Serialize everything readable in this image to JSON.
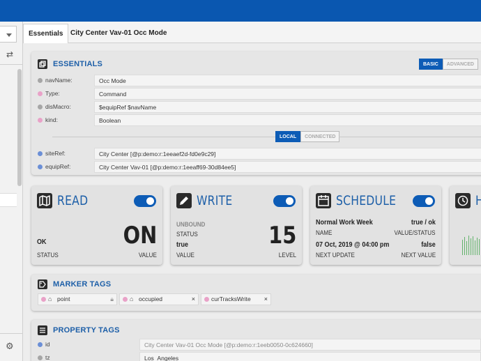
{
  "tabs": [
    "Essentials",
    "City Center Vav-01 Occ Mode"
  ],
  "essentials": {
    "title": "ESSENTIALS",
    "mode_basic": "BASIC",
    "mode_advanced": "ADVANCED",
    "local": "LOCAL",
    "connected": "CONNECTED",
    "rows": [
      {
        "label": "navName:",
        "value": "Occ Mode",
        "color": "#a6a6a6"
      },
      {
        "label": "Type:",
        "value": "Command",
        "color": "#e9a2c8"
      },
      {
        "label": "disMacro:",
        "value": "$equipRef $navName",
        "color": "#a6a6a6"
      },
      {
        "label": "kind:",
        "value": "Boolean",
        "color": "#e9a2c8"
      }
    ],
    "refs": [
      {
        "label": "siteRef:",
        "value": "City Center [@p:demo:r:1eeaef2d-fd0e9c29]",
        "color": "#6b8fd6"
      },
      {
        "label": "equipRef:",
        "value": "City Center Vav-01 [@p:demo:r:1eeaff69-30d84ee5]",
        "color": "#6b8fd6"
      }
    ]
  },
  "read": {
    "title": "READ",
    "value": "ON",
    "status": "OK",
    "status_label": "STATUS",
    "value_label": "VALUE"
  },
  "write": {
    "title": "WRITE",
    "unbound": "UNBOUND",
    "status_label": "STATUS",
    "val": "true",
    "value_label": "VALUE",
    "level": "15",
    "level_label": "LEVEL"
  },
  "schedule": {
    "title": "SCHEDULE",
    "name": "Normal Work Week",
    "name_label": "NAME",
    "vs": "true / ok",
    "vs_label": "VALUE/STATUS",
    "next_update": "07 Oct, 2019 @ 04:00 pm",
    "next_update_label": "NEXT UPDATE",
    "next_value": "false",
    "next_value_label": "NEXT VALUE"
  },
  "history": {
    "title": "H"
  },
  "marker_tags": {
    "title": "MARKER TAGS",
    "chips": [
      {
        "text": "point",
        "action": "lock-icon"
      },
      {
        "text": "occupied",
        "action": "close-icon",
        "x": "×"
      },
      {
        "text": "curTracksWrite",
        "action": "close-icon",
        "x": "×"
      }
    ]
  },
  "property_tags": {
    "title": "PROPERTY TAGS",
    "rows": [
      {
        "label": "id",
        "value": "City Center Vav-01 Occ Mode [@p:demo:r:1eeb0050-0c624660]",
        "color": "#6b8fd6"
      },
      {
        "label": "tz",
        "value": "Los_Angeles",
        "color": "#a6a6a6"
      }
    ]
  },
  "colors": {
    "topbar": "#0a57b0",
    "accent": "#1d5fa8",
    "toggle": "#0d5cb6"
  }
}
